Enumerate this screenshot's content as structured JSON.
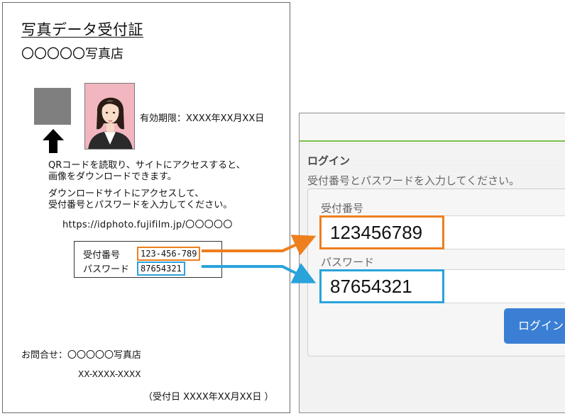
{
  "receipt": {
    "title": "写真データ受付証",
    "shop_name": "〇〇〇〇〇写真店",
    "expiry": "有効期限：XXXX年XX月XX日",
    "instruction_1": "QRコードを読取り、サイトにアクセスすると、\n画像をダウンロードできます。",
    "instruction_2": "ダウンロードサイトにアクセスして、\n受付番号とパスワードを入力してください。",
    "url": "https://idphoto.fujifilm.jp/〇〇〇〇〇",
    "credentials": {
      "receipt_number_label": "受付番号",
      "receipt_number_value": "123-456-789",
      "password_label": "パスワード",
      "password_value": "87654321"
    },
    "contact_label": "お問合せ：〇〇〇〇〇写真店",
    "contact_phone": "XX-XXXX-XXXX",
    "received_date": "（受付日 XXXX年XX月XX日 ）"
  },
  "login_screen": {
    "heading": "ログイン",
    "description": "受付番号とパスワードを入力してください。",
    "receipt_number_label": "受付番号",
    "receipt_number_value": "123456789",
    "password_label": "パスワード",
    "password_value": "87654321",
    "login_button": "ログイン"
  },
  "colors": {
    "receipt_highlight": "#ee7f1e",
    "password_highlight": "#29a3da",
    "accent_bar": "#7dc04a",
    "button": "#3a7fd4"
  },
  "icons": {
    "qr_placeholder": "qr-code-placeholder",
    "up_arrow": "up-arrow-icon",
    "photo": "id-photo-illustration"
  }
}
